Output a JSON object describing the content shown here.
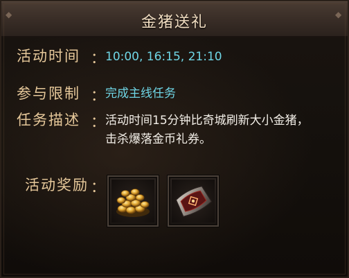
{
  "header": {
    "title": "金猪送礼"
  },
  "info": {
    "time_label": "活动时间",
    "time_value": "10:00,   16:15,   21:10",
    "limit_label": "参与限制",
    "limit_value": "完成主线任务",
    "desc_label": "任务描述",
    "desc_line1": "活动时间15分钟比奇城刷新大小金猪，",
    "desc_line2": "击杀爆落金币礼券。",
    "colon": "："
  },
  "rewards": {
    "label": "活动奖励",
    "items": [
      {
        "icon": "gold-coins-icon"
      },
      {
        "icon": "voucher-scroll-icon"
      }
    ]
  },
  "colors": {
    "label_gold": "#e6c89a",
    "value_cyan": "#6fd6e6",
    "text_white": "#f3efe8"
  }
}
